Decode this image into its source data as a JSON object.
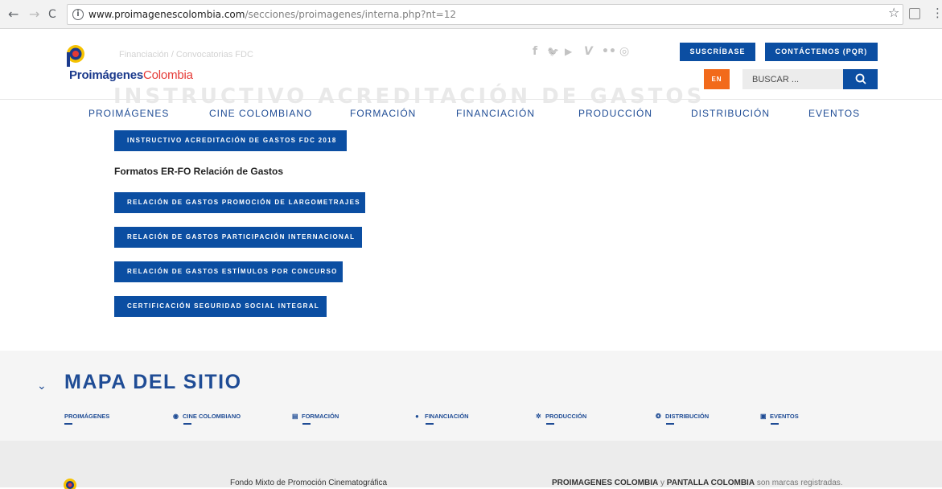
{
  "browser": {
    "url_host": "www.proimagenescolombia.com",
    "url_path": "/secciones/proimagenes/interna.php?nt=12",
    "back_glyph": "←",
    "forward_glyph": "→",
    "reload_glyph": "C",
    "info_glyph": "i",
    "star_glyph": "☆",
    "menu_glyph": "⋮"
  },
  "header": {
    "logo_text_bold": "Proimágenes",
    "logo_text_light": "Colombia",
    "breadcrumb": "Financiación / Convocatorias FDC",
    "ghost_title": "INSTRUCTIVO ACREDITACIÓN DE GASTOS",
    "socials": [
      "f",
      "🐦",
      "▶",
      "V",
      "••",
      "◎"
    ],
    "subscribe_label": "SUSCRÍBASE",
    "contact_label": "CONTÁCTENOS (PQR)",
    "lang_label": "EN",
    "search_placeholder": "BUSCAR ..."
  },
  "nav": {
    "items": [
      "PROIMÁGENES",
      "CINE COLOMBIANO",
      "FORMACIÓN",
      "FINANCIACIÓN",
      "PRODUCCIÓN",
      "DISTRIBUCIÓN",
      "EVENTOS"
    ]
  },
  "content": {
    "instructivo_button": "INSTRUCTIVO ACREDITACIÓN DE GASTOS FDC 2018",
    "formats_heading": "Formatos ER-FO Relación de Gastos",
    "format_buttons": [
      "RELACIÓN DE GASTOS PROMOCIÓN DE LARGOMETRAJES",
      "RELACIÓN DE GASTOS PARTICIPACIÓN INTERNACIONAL",
      "RELACIÓN DE GASTOS ESTÍMULOS POR CONCURSO",
      "CERTIFICACIÓN SEGURIDAD SOCIAL INTEGRAL"
    ]
  },
  "sitemap": {
    "chevron": "⌄",
    "title": "MAPA DEL SITIO",
    "links": [
      {
        "label": "PROIMÁGENES",
        "icon": ""
      },
      {
        "label": "CINE COLOMBIANO",
        "icon": "◉"
      },
      {
        "label": "FORMACIÓN",
        "icon": "▤"
      },
      {
        "label": "FINANCIACIÓN",
        "icon": "●"
      },
      {
        "label": "PRODUCCIÓN",
        "icon": "✲"
      },
      {
        "label": "DISTRIBUCIÓN",
        "icon": "❂"
      },
      {
        "label": "EVENTOS",
        "icon": "▣"
      }
    ]
  },
  "footer": {
    "left_text": "Fondo Mixto de Promoción Cinematográfica",
    "right_brand_1": "PROIMAGENES COLOMBIA",
    "right_connector": " y ",
    "right_brand_2": "PANTALLA COLOMBIA",
    "right_tail": " son marcas registradas."
  },
  "colors": {
    "brand_blue": "#0b4ea2",
    "nav_blue": "#1f4c95",
    "accent_orange": "#f26a1b",
    "logo_red": "#e53935",
    "logo_yellow": "#f6c200"
  }
}
